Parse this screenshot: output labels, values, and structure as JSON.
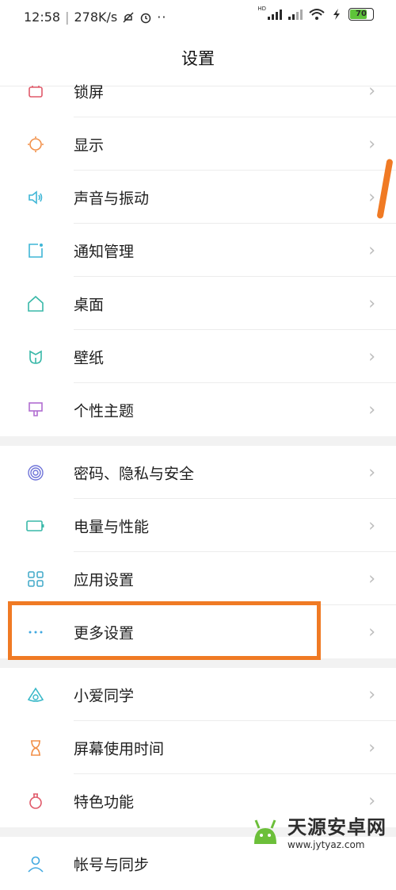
{
  "status": {
    "time": "12:58",
    "speed": "278K/s",
    "battery": "70",
    "hd_label": "HD"
  },
  "header": {
    "title": "设置"
  },
  "items_group1": [
    {
      "label": "锁屏",
      "icon": "lock-screen-icon",
      "color": "#e05a6a"
    },
    {
      "label": "显示",
      "icon": "sun-icon",
      "color": "#f2914a"
    },
    {
      "label": "声音与振动",
      "icon": "speaker-icon",
      "color": "#3fb6d6"
    },
    {
      "label": "通知管理",
      "icon": "notification-icon",
      "color": "#3fb6d6"
    },
    {
      "label": "桌面",
      "icon": "home-icon",
      "color": "#38b8a8"
    },
    {
      "label": "壁纸",
      "icon": "flower-icon",
      "color": "#38b8a8"
    },
    {
      "label": "个性主题",
      "icon": "brush-icon",
      "color": "#b06dd0"
    }
  ],
  "items_group2": [
    {
      "label": "密码、隐私与安全",
      "icon": "fingerprint-icon",
      "color": "#6f74d8"
    },
    {
      "label": "电量与性能",
      "icon": "battery-icon",
      "color": "#38b8a8"
    },
    {
      "label": "应用设置",
      "icon": "apps-grid-icon",
      "color": "#3fa8c8"
    },
    {
      "label": "更多设置",
      "icon": "more-dots-icon",
      "color": "#3fa8e0"
    }
  ],
  "items_group3": [
    {
      "label": "小爱同学",
      "icon": "xiaoai-icon",
      "color": "#38b8c8"
    },
    {
      "label": "屏幕使用时间",
      "icon": "hourglass-icon",
      "color": "#f2914a"
    },
    {
      "label": "特色功能",
      "icon": "potion-icon",
      "color": "#e05a6a"
    }
  ],
  "items_group4": [
    {
      "label": "帐号与同步",
      "icon": "account-icon",
      "color": "#3fa8e0"
    }
  ],
  "watermark": {
    "name": "天源安卓网",
    "url": "www.jytyaz.com"
  }
}
